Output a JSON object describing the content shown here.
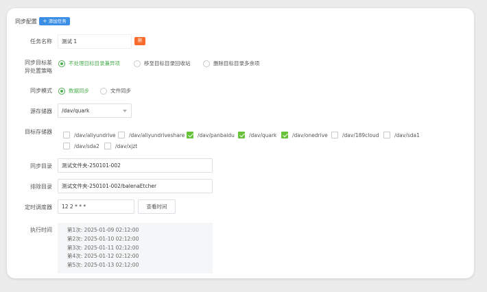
{
  "header": {
    "title": "同步配置",
    "add_label": "添加任务",
    "add_icon": "plus-icon"
  },
  "labels": {
    "task_name": "任务名称",
    "strategy_line1": "同步目标差",
    "strategy_line2": "异处置策略",
    "sync_mode": "同步模式",
    "source": "源存储器",
    "target": "目标存储器",
    "sync_dir": "同步目录",
    "exclude_dir": "排除目录",
    "scheduler": "定时调度器",
    "exec_time": "执行时间"
  },
  "task_name": {
    "value": "测试 1",
    "delete_label": "删"
  },
  "strategy": {
    "options": [
      {
        "label": "不处理目标目录兼异项",
        "selected": true
      },
      {
        "label": "移至目标目录回收站",
        "selected": false
      },
      {
        "label": "删除目标目录多余项",
        "selected": false
      }
    ]
  },
  "sync_mode": {
    "options": [
      {
        "label": "数据同步",
        "selected": true
      },
      {
        "label": "文件同步",
        "selected": false
      }
    ]
  },
  "source": {
    "value": "/dav/quark"
  },
  "targets": [
    {
      "label": "/dav/aliyundrive",
      "checked": false
    },
    {
      "label": "/dav/aliyundriveshare",
      "checked": false
    },
    {
      "label": "/dav/panbaidu",
      "checked": true
    },
    {
      "label": "/dav/quark",
      "checked": true
    },
    {
      "label": "/dav/onedrive",
      "checked": true
    },
    {
      "label": "/dav/189cloud",
      "checked": false
    },
    {
      "label": "/dav/sda1",
      "checked": false
    },
    {
      "label": "/dav/sda2",
      "checked": false
    },
    {
      "label": "/dav/xjzt",
      "checked": false
    }
  ],
  "sync_dir": {
    "value": "测试文件夹-250101-002"
  },
  "exclude_dir": {
    "value": "测试文件夹-250101-002/balenaEtcher"
  },
  "scheduler": {
    "value": "12 2 * * *",
    "view_label": "查看时间"
  },
  "exec_times": [
    "第1次: 2025-01-09 02:12:00",
    "第2次: 2025-01-10 02:12:00",
    "第3次: 2025-01-11 02:12:00",
    "第4次: 2025-01-12 02:12:00",
    "第5次: 2025-01-13 02:12:00"
  ]
}
